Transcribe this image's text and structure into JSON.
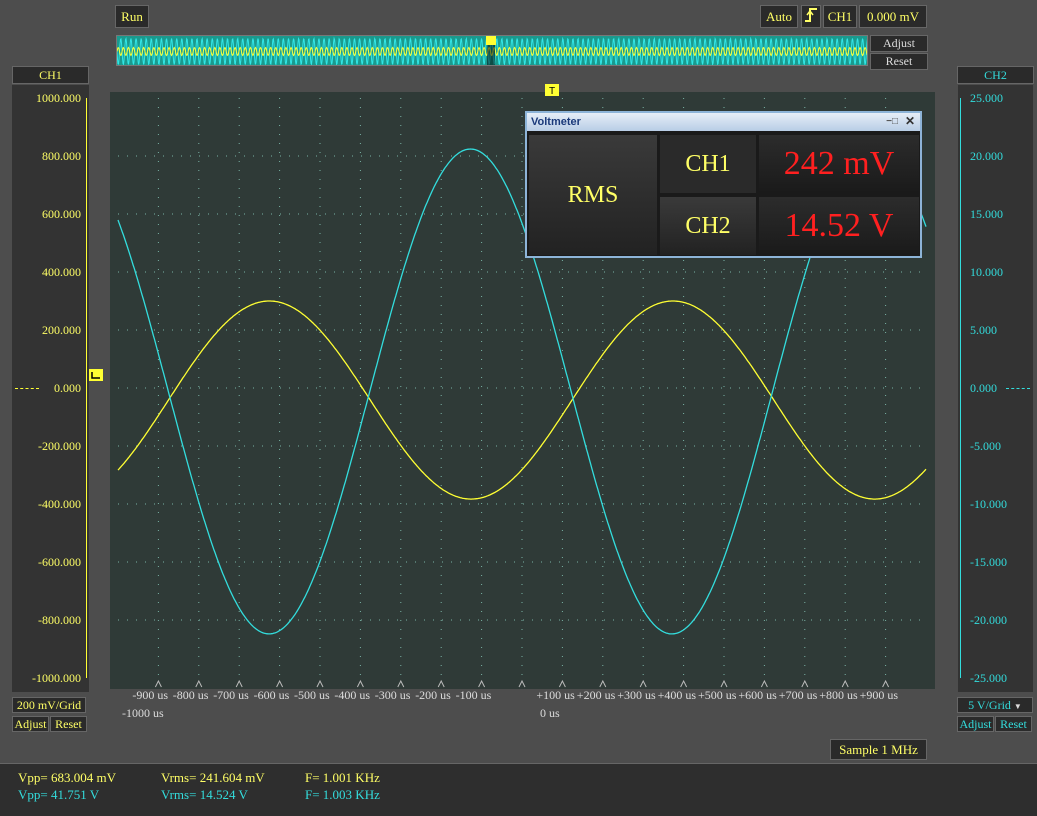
{
  "toolbar": {
    "run_label": "Run",
    "auto_label": "Auto",
    "trigger_channel": "CH1",
    "trigger_level": "0.000 mV",
    "adjust_label": "Adjust",
    "reset_label": "Reset",
    "trigger_marker": "T"
  },
  "ch1": {
    "title": "CH1",
    "color": "#ffff33",
    "ticks": [
      "1000.000",
      "800.000",
      "600.000",
      "400.000",
      "200.000",
      "0.000",
      "-200.000",
      "-400.000",
      "-600.000",
      "-800.000",
      "-1000.000"
    ],
    "scale": "200 mV/Grid",
    "adjust_label": "Adjust",
    "reset_label": "Reset"
  },
  "ch2": {
    "title": "CH2",
    "color": "#33dddd",
    "ticks": [
      "25.000",
      "20.000",
      "15.000",
      "10.000",
      "5.000",
      "0.000",
      "-5.000",
      "-10.000",
      "-15.000",
      "-20.000",
      "-25.000"
    ],
    "scale": "5 V/Grid",
    "adjust_label": "Adjust",
    "reset_label": "Reset"
  },
  "timebase": {
    "labels": [
      "-900 us",
      "-800 us",
      "-700 us",
      "-600 us",
      "-500 us",
      "-400 us",
      "-300 us",
      "-200 us",
      "-100 us",
      "",
      "+100 us",
      "+200 us",
      "+300 us",
      "+400 us",
      "+500 us",
      "+600 us",
      "+700 us",
      "+800 us",
      "+900 us"
    ],
    "left_label": "-1000 us",
    "center_label": "0 us",
    "sample_label": "Sample 1 MHz"
  },
  "chart_data": {
    "type": "line",
    "x_unit": "us",
    "xlim": [
      -1000,
      1000
    ],
    "series": [
      {
        "name": "CH1",
        "unit": "mV",
        "ylim": [
          -1000,
          1000
        ],
        "frequency_khz": 1.001,
        "peak_max": 300,
        "peak_min": -383,
        "phase_deg": 0
      },
      {
        "name": "CH2",
        "unit": "V",
        "ylim": [
          -25,
          25
        ],
        "frequency_khz": 1.003,
        "peak_max": 20.6,
        "peak_min": -21.2,
        "phase_deg": 180
      }
    ],
    "grid": true
  },
  "measurements": {
    "ch1": {
      "vpp": "Vpp= 683.004 mV",
      "vrms": "Vrms= 241.604 mV",
      "freq": "F= 1.001 KHz"
    },
    "ch2": {
      "vpp": "Vpp= 41.751 V",
      "vrms": "Vrms= 14.524 V",
      "freq": "F= 1.003 KHz"
    }
  },
  "voltmeter": {
    "title": "Voltmeter",
    "mode": "RMS",
    "ch1_label": "CH1",
    "ch1_value": "242 mV",
    "ch2_label": "CH2",
    "ch2_value": "14.52 V"
  }
}
